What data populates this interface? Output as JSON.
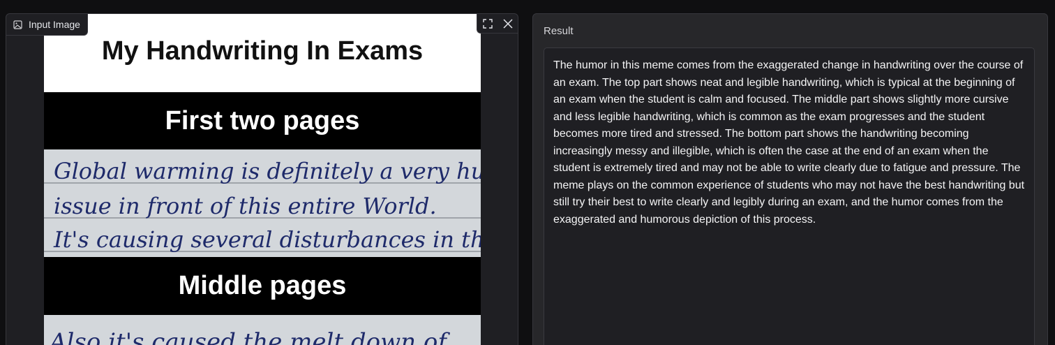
{
  "input_panel": {
    "label": "Input Image",
    "icon": "image-icon",
    "tools": [
      "fullscreen-icon",
      "close-icon"
    ],
    "meme": {
      "title": "My Handwriting In Exams",
      "section1": "First two pages",
      "handwriting1": [
        "Global warming is definitely a very huge",
        "issue in front of this entire World.",
        "It's causing several disturbances in the"
      ],
      "section2": "Middle pages",
      "handwriting2": [
        "Also it's caused the melt down of"
      ]
    }
  },
  "result_panel": {
    "label": "Result",
    "text": "The humor in this meme comes from the exaggerated change in handwriting over the course of an exam. The top part shows neat and legible handwriting, which is typical at the beginning of an exam when the student is calm and focused. The middle part shows slightly more cursive and less legible handwriting, which is common as the exam progresses and the student becomes more tired and stressed. The bottom part shows the handwriting becoming increasingly messy and illegible, which is often the case at the end of an exam when the student is extremely tired and may not be able to write clearly due to fatigue and pressure. The meme plays on the common experience of students who may not have the best handwriting but still try their best to write clearly and legibly during an exam, and the humor comes from the exaggerated and humorous depiction of this process."
  }
}
